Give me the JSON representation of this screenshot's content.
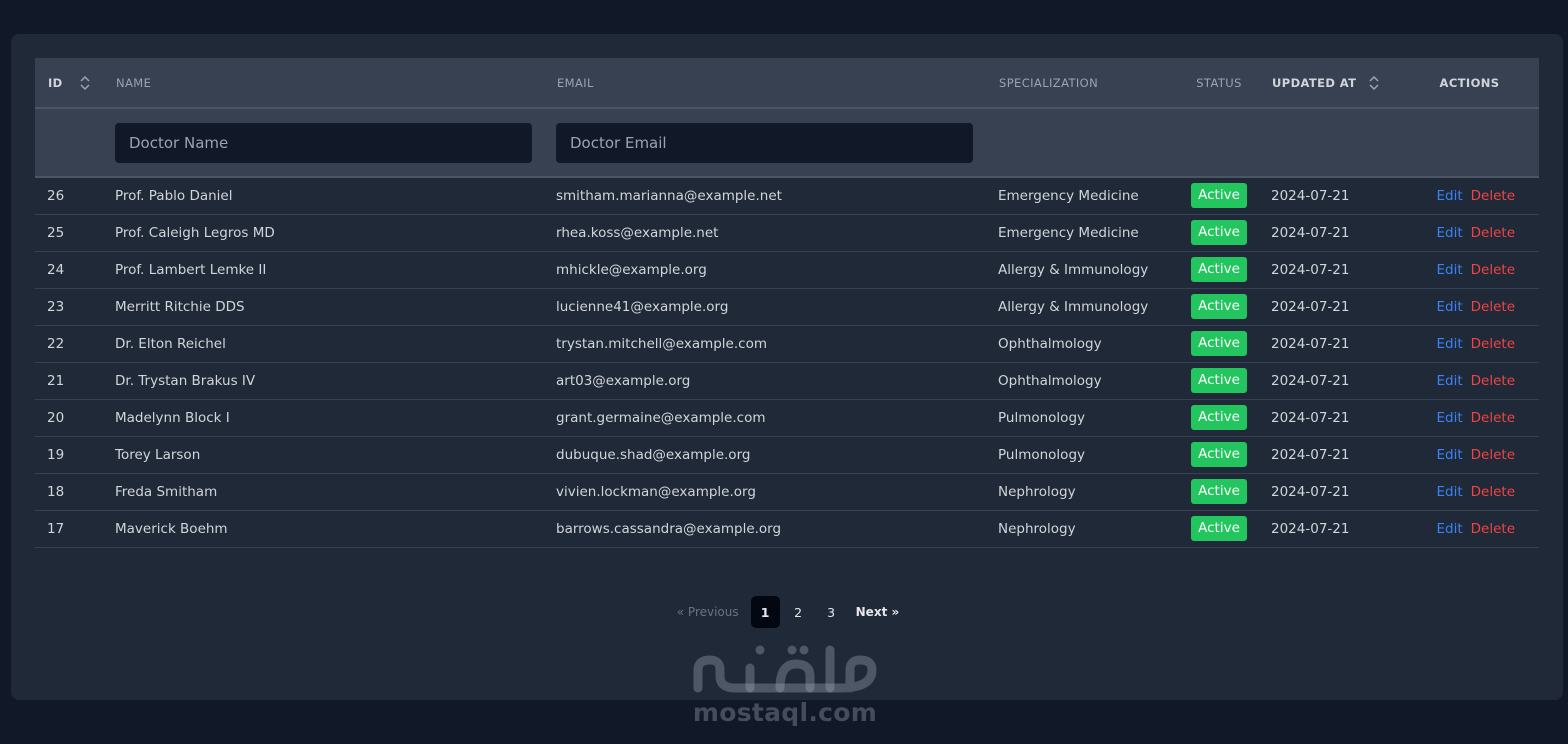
{
  "table": {
    "headers": {
      "id": "ID",
      "name": "NAME",
      "email": "EMAIL",
      "specialization": "SPECIALIZATION",
      "status": "STATUS",
      "updated_at": "UPDATED AT",
      "actions": "ACTIONS"
    },
    "filters": {
      "name_placeholder": "Doctor Name",
      "email_placeholder": "Doctor Email",
      "name_value": "",
      "email_value": ""
    },
    "rows": [
      {
        "id": "26",
        "name": "Prof. Pablo Daniel",
        "email": "smitham.marianna@example.net",
        "specialization": "Emergency Medicine",
        "status": "Active",
        "updated_at": "2024-07-21"
      },
      {
        "id": "25",
        "name": "Prof. Caleigh Legros MD",
        "email": "rhea.koss@example.net",
        "specialization": "Emergency Medicine",
        "status": "Active",
        "updated_at": "2024-07-21"
      },
      {
        "id": "24",
        "name": "Prof. Lambert Lemke II",
        "email": "mhickle@example.org",
        "specialization": "Allergy & Immunology",
        "status": "Active",
        "updated_at": "2024-07-21"
      },
      {
        "id": "23",
        "name": "Merritt Ritchie DDS",
        "email": "lucienne41@example.org",
        "specialization": "Allergy & Immunology",
        "status": "Active",
        "updated_at": "2024-07-21"
      },
      {
        "id": "22",
        "name": "Dr. Elton Reichel",
        "email": "trystan.mitchell@example.com",
        "specialization": "Ophthalmology",
        "status": "Active",
        "updated_at": "2024-07-21"
      },
      {
        "id": "21",
        "name": "Dr. Trystan Brakus IV",
        "email": "art03@example.org",
        "specialization": "Ophthalmology",
        "status": "Active",
        "updated_at": "2024-07-21"
      },
      {
        "id": "20",
        "name": "Madelynn Block I",
        "email": "grant.germaine@example.com",
        "specialization": "Pulmonology",
        "status": "Active",
        "updated_at": "2024-07-21"
      },
      {
        "id": "19",
        "name": "Torey Larson",
        "email": "dubuque.shad@example.org",
        "specialization": "Pulmonology",
        "status": "Active",
        "updated_at": "2024-07-21"
      },
      {
        "id": "18",
        "name": "Freda Smitham",
        "email": "vivien.lockman@example.org",
        "specialization": "Nephrology",
        "status": "Active",
        "updated_at": "2024-07-21"
      },
      {
        "id": "17",
        "name": "Maverick Boehm",
        "email": "barrows.cassandra@example.org",
        "specialization": "Nephrology",
        "status": "Active",
        "updated_at": "2024-07-21"
      }
    ],
    "row_actions": {
      "edit": "Edit",
      "delete": "Delete"
    }
  },
  "pagination": {
    "previous": "« Previous",
    "pages": [
      "1",
      "2",
      "3"
    ],
    "current": "1",
    "next": "Next »"
  },
  "watermark": {
    "arabic": "مستقل",
    "latin": "mostaql.com"
  },
  "colors": {
    "page_bg": "#111827",
    "card_bg": "#1f2937",
    "header_bg": "#374151",
    "badge_active": "#22c55e",
    "edit_link": "#3b82f6",
    "delete_link": "#ef4444"
  },
  "icons": {
    "sort": "sort-icon"
  }
}
